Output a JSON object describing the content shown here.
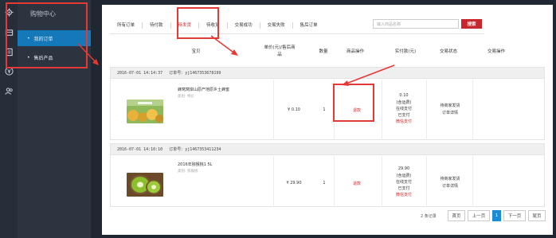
{
  "sidebar": {
    "title": "购物中心",
    "items": [
      {
        "label": "我的订单",
        "bullet": "•"
      },
      {
        "label": "售后产品",
        "bullet": "•"
      }
    ],
    "rail_icons": [
      "gear-icon",
      "cart-icon",
      "list-icon",
      "yen-icon",
      "users-icon"
    ]
  },
  "tabs": [
    "所有订单",
    "待付款",
    "待发货",
    "待收货",
    "交易成功",
    "交易失败",
    "售后订单"
  ],
  "search": {
    "placeholder": "输入商品名称",
    "button": "搜索"
  },
  "columns": {
    "product": "宝贝",
    "price": "单价(元)/售后商",
    "price2": "品",
    "qty": "数量",
    "ops": "商品操作",
    "paid": "实付款(元)",
    "status": "交易状态",
    "actions": "交易操作"
  },
  "orders": [
    {
      "date": "2016-07-01 14:14:37",
      "order_no": "订单号：yj1467353678199",
      "product_name": "蜂窝窝岸山原产地原乡土蜂蜜",
      "spec": "类别: 特价",
      "price": "¥ 0.10",
      "qty": "1",
      "op": "退款",
      "paid_amount": "0.10",
      "paid_note": "(含运费)",
      "paid_method": "在线支付",
      "paid_state": "已支付",
      "paid_channel": "微信支付",
      "status": "待商家发货",
      "status_link": "订单详情"
    },
    {
      "date": "2016-07-01 14:10:10",
      "order_no": "订单号：yj1467353411234",
      "product_name": "2016年猕猴桃1 5L",
      "spec": "类别: 猕猴桃",
      "price": "¥ 29.90",
      "qty": "1",
      "op": "退款",
      "paid_amount": "29.90",
      "paid_note": "(含运费)",
      "paid_method": "在线支付",
      "paid_state": "已支付",
      "paid_channel": "微信支付",
      "status": "待商家发货",
      "status_link": "订单详情"
    }
  ],
  "pagination": {
    "count_text": "2 条记录",
    "first": "首页",
    "prev": "上一页",
    "current": "1",
    "next": "下一页",
    "last": "尾页"
  },
  "colors": {
    "accent": "#d22222",
    "nav_active": "#1478b9",
    "annotation": "#e53935"
  }
}
